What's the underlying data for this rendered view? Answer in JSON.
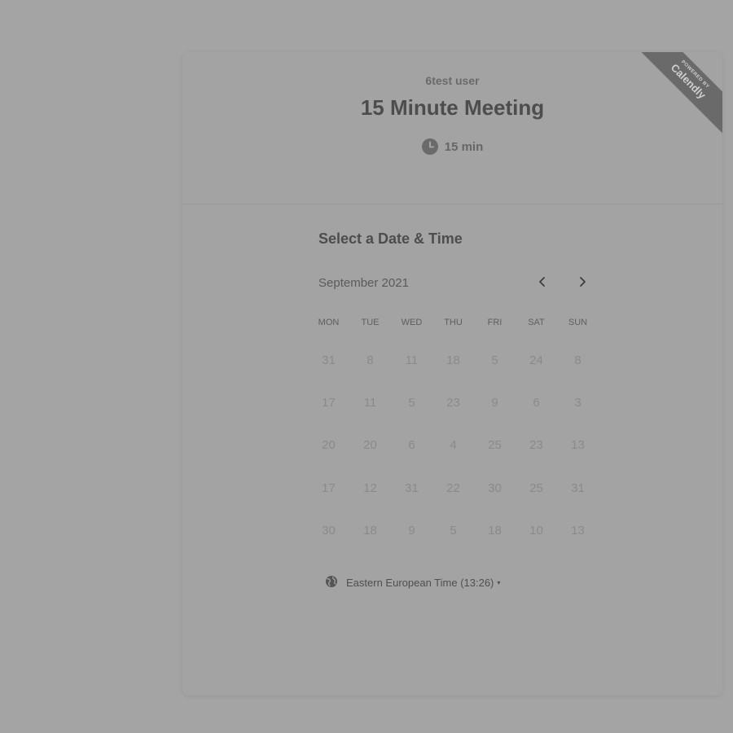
{
  "event": {
    "host_name": "6test user",
    "title": "15 Minute Meeting",
    "duration": "15 min",
    "duration_icon": "clock-icon"
  },
  "ribbon": {
    "powered_by": "POWERED BY",
    "brand": "Calendly"
  },
  "scheduler": {
    "section_title": "Select a Date & Time",
    "month": "September 2021",
    "prev_icon": "chevron-left-icon",
    "next_icon": "chevron-right-icon",
    "weekdays": [
      "MON",
      "TUE",
      "WED",
      "THU",
      "FRI",
      "SAT",
      "SUN"
    ],
    "weeks": [
      [
        "31",
        "8",
        "11",
        "18",
        "5",
        "24",
        "8"
      ],
      [
        "17",
        "11",
        "5",
        "23",
        "9",
        "6",
        "3"
      ],
      [
        "20",
        "20",
        "6",
        "4",
        "25",
        "23",
        "13"
      ],
      [
        "17",
        "12",
        "31",
        "22",
        "30",
        "25",
        "31"
      ],
      [
        "30",
        "18",
        "9",
        "5",
        "18",
        "10",
        "13"
      ]
    ]
  },
  "timezone": {
    "icon": "globe-icon",
    "label": "Eastern European Time (13:26)",
    "caret": "▾"
  },
  "colors": {
    "background": "#a4a4a4",
    "ribbon": "#6a6a6a",
    "title_text": "#4d4d4d",
    "day_text": "#8a8a8a"
  }
}
